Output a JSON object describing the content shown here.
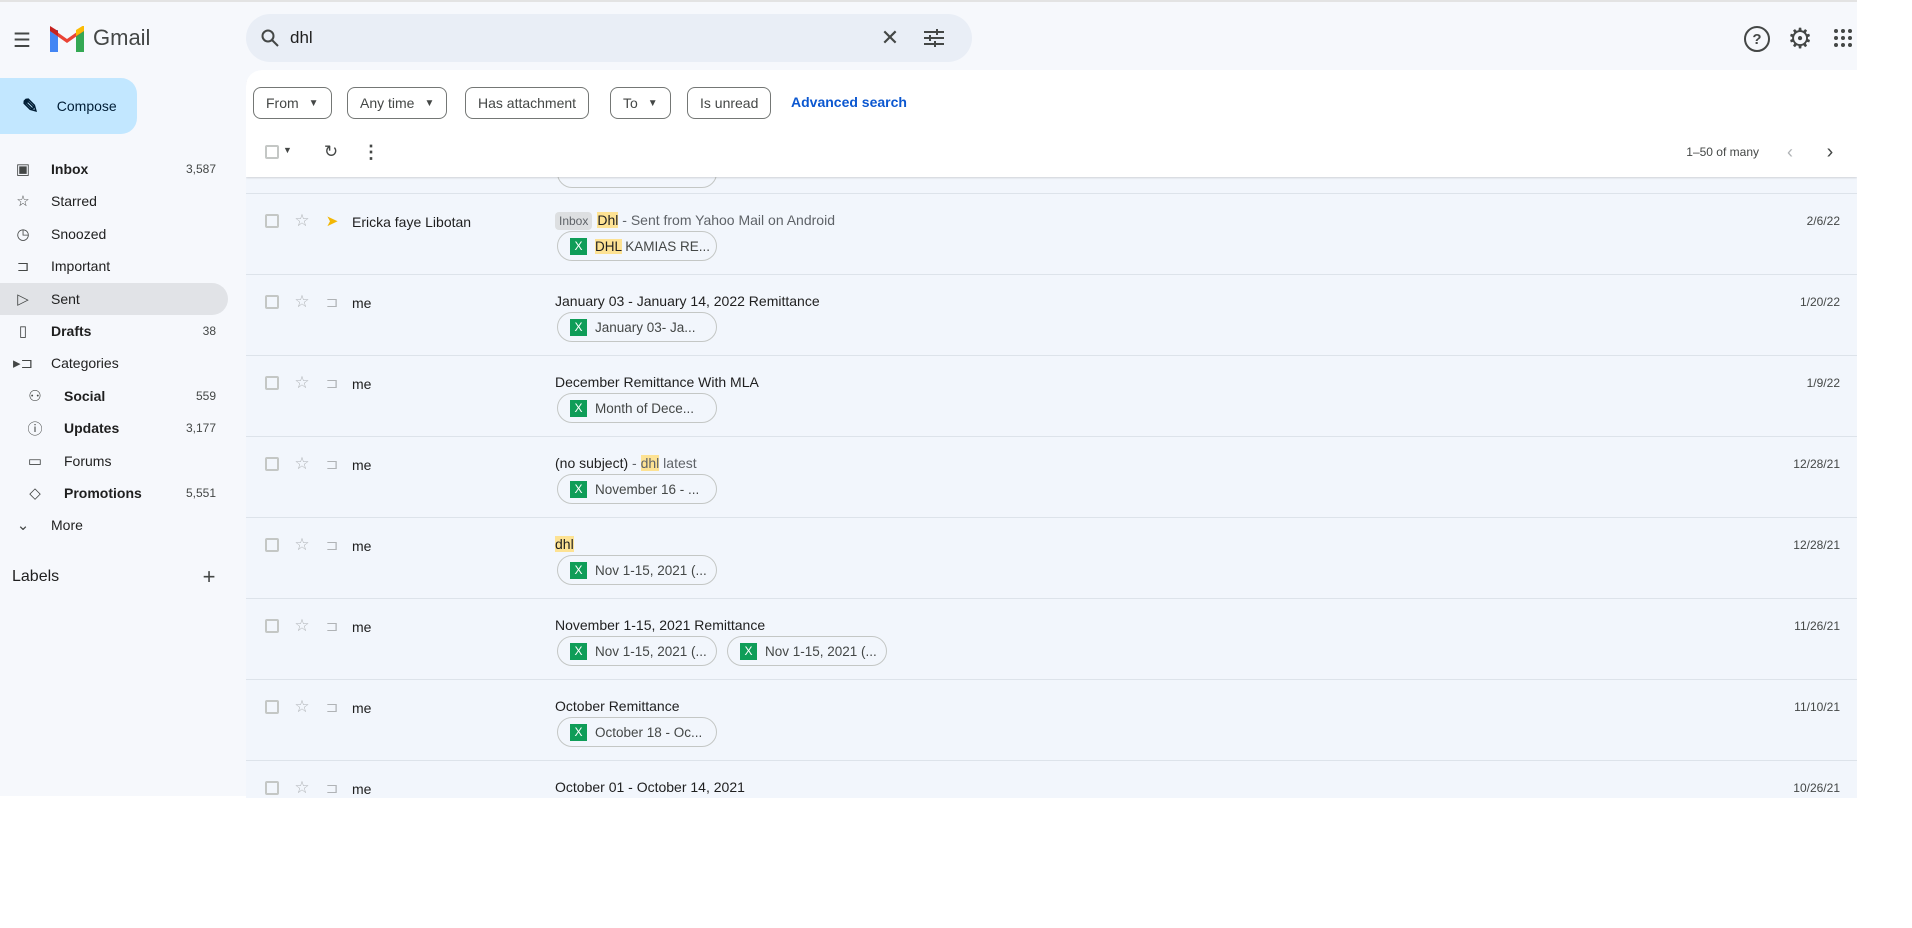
{
  "app": {
    "name": "Gmail",
    "compose": "Compose"
  },
  "search": {
    "query": "dhl"
  },
  "sidebar": {
    "items": [
      {
        "label": "Inbox",
        "count": "3,587",
        "icon": "inbox-icon",
        "glyph": "▣",
        "bold": true,
        "sub": false
      },
      {
        "label": "Starred",
        "count": "",
        "icon": "star-icon",
        "glyph": "☆",
        "bold": false,
        "sub": false
      },
      {
        "label": "Snoozed",
        "count": "",
        "icon": "clock-icon",
        "glyph": "◷",
        "bold": false,
        "sub": false
      },
      {
        "label": "Important",
        "count": "",
        "icon": "important-icon",
        "glyph": "⊐",
        "bold": false,
        "sub": false
      },
      {
        "label": "Sent",
        "count": "",
        "icon": "send-icon",
        "glyph": "▷",
        "bold": false,
        "sub": false,
        "active": true
      },
      {
        "label": "Drafts",
        "count": "38",
        "icon": "draft-icon",
        "glyph": "▯",
        "bold": true,
        "sub": false
      },
      {
        "label": "Categories",
        "count": "",
        "icon": "label-icon",
        "glyph": "▸⊐",
        "bold": false,
        "sub": false
      },
      {
        "label": "Social",
        "count": "559",
        "icon": "people-icon",
        "glyph": "⚇",
        "bold": true,
        "sub": true
      },
      {
        "label": "Updates",
        "count": "3,177",
        "icon": "info-icon",
        "glyph": "ⓘ",
        "bold": true,
        "sub": true
      },
      {
        "label": "Forums",
        "count": "",
        "icon": "forum-icon",
        "glyph": "▭",
        "bold": false,
        "sub": true
      },
      {
        "label": "Promotions",
        "count": "5,551",
        "icon": "tag-icon",
        "glyph": "◇",
        "bold": true,
        "sub": true
      },
      {
        "label": "More",
        "count": "",
        "icon": "chevron-down-icon",
        "glyph": "⌄",
        "bold": false,
        "sub": false
      }
    ],
    "labels_heading": "Labels"
  },
  "filters": [
    {
      "label": "From",
      "dropdown": true
    },
    {
      "label": "Any time",
      "dropdown": true
    },
    {
      "label": "Has attachment",
      "dropdown": false
    },
    {
      "label": "To",
      "dropdown": true
    },
    {
      "label": "Is unread",
      "dropdown": false
    }
  ],
  "advanced_search": "Advanced search",
  "pagination": "1–50 of many",
  "emails": [
    {
      "sender": "Ericka faye Libotan",
      "badge": "Inbox",
      "important": true,
      "parts": [
        {
          "t": "Dhl",
          "hl": true
        },
        {
          "t": " - Sent from Yahoo Mail on Android",
          "snip": true
        }
      ],
      "attachments": [
        [
          {
            "t": "DHL",
            "hl": true
          },
          {
            "t": " KAMIAS RE..."
          }
        ]
      ],
      "date": "2/6/22"
    },
    {
      "sender": "me",
      "parts": [
        {
          "t": "January 03 - January 14, 2022 Remittance"
        }
      ],
      "attachments": [
        [
          {
            "t": "January 03- Ja..."
          }
        ]
      ],
      "date": "1/20/22"
    },
    {
      "sender": "me",
      "parts": [
        {
          "t": "December Remittance With MLA"
        }
      ],
      "attachments": [
        [
          {
            "t": "Month of Dece..."
          }
        ]
      ],
      "date": "1/9/22"
    },
    {
      "sender": "me",
      "parts": [
        {
          "t": "(no subject)"
        },
        {
          "t": " - ",
          "snip": true
        },
        {
          "t": "dhl",
          "hl": true,
          "snip": true
        },
        {
          "t": " latest",
          "snip": true
        }
      ],
      "attachments": [
        [
          {
            "t": "November 16 - ..."
          }
        ]
      ],
      "date": "12/28/21"
    },
    {
      "sender": "me",
      "parts": [
        {
          "t": "dhl",
          "hl": true
        }
      ],
      "attachments": [
        [
          {
            "t": "Nov 1-15, 2021 (..."
          }
        ]
      ],
      "date": "12/28/21"
    },
    {
      "sender": "me",
      "parts": [
        {
          "t": "November 1-15, 2021 Remittance"
        }
      ],
      "attachments": [
        [
          {
            "t": "Nov 1-15, 2021 (..."
          }
        ],
        [
          {
            "t": "Nov 1-15, 2021 (..."
          }
        ]
      ],
      "date": "11/26/21"
    },
    {
      "sender": "me",
      "parts": [
        {
          "t": "October Remittance"
        }
      ],
      "attachments": [
        [
          {
            "t": "October 18 - Oc..."
          }
        ]
      ],
      "date": "11/10/21"
    },
    {
      "sender": "me",
      "parts": [
        {
          "t": "October 01 - October 14, 2021"
        }
      ],
      "attachments": [],
      "date": "10/26/21"
    }
  ]
}
